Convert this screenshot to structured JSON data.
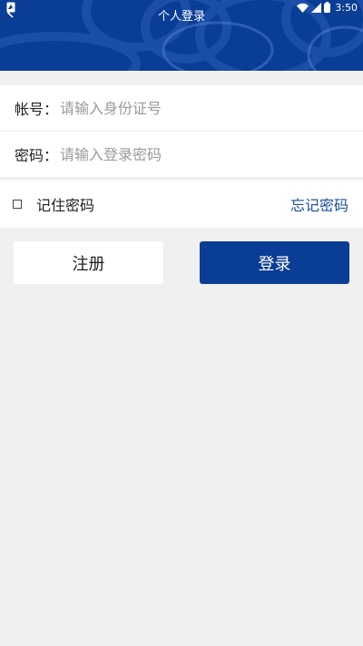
{
  "status_bar": {
    "time": "3:50",
    "icons": [
      "app-notification-icon",
      "wifi-icon",
      "cell-signal-icon",
      "battery-icon"
    ]
  },
  "header": {
    "title": "个人登录",
    "back_icon": "back-chevron-icon"
  },
  "form": {
    "account_label": "帐号：",
    "account_placeholder": "请输入身份证号",
    "password_label": "密码：",
    "password_placeholder": "请输入登录密码"
  },
  "remember": {
    "label": "记住密码",
    "checked": false,
    "forgot_link": "忘记密码"
  },
  "buttons": {
    "register": "注册",
    "login": "登录"
  },
  "colors": {
    "brand_blue": "#0a3d96",
    "link_blue": "#1a4fa3",
    "background": "#f0f0f0"
  }
}
